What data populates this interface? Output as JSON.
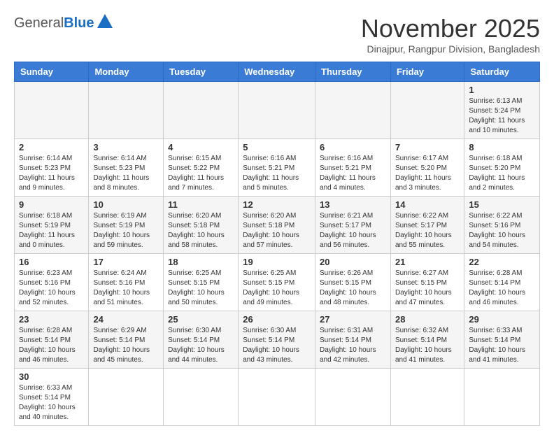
{
  "header": {
    "logo_general": "General",
    "logo_blue": "Blue",
    "month_title": "November 2025",
    "subtitle": "Dinajpur, Rangpur Division, Bangladesh"
  },
  "weekdays": [
    "Sunday",
    "Monday",
    "Tuesday",
    "Wednesday",
    "Thursday",
    "Friday",
    "Saturday"
  ],
  "weeks": [
    [
      {
        "day": "",
        "info": ""
      },
      {
        "day": "",
        "info": ""
      },
      {
        "day": "",
        "info": ""
      },
      {
        "day": "",
        "info": ""
      },
      {
        "day": "",
        "info": ""
      },
      {
        "day": "",
        "info": ""
      },
      {
        "day": "1",
        "info": "Sunrise: 6:13 AM\nSunset: 5:24 PM\nDaylight: 11 hours and 10 minutes."
      }
    ],
    [
      {
        "day": "2",
        "info": "Sunrise: 6:14 AM\nSunset: 5:23 PM\nDaylight: 11 hours and 9 minutes."
      },
      {
        "day": "3",
        "info": "Sunrise: 6:14 AM\nSunset: 5:23 PM\nDaylight: 11 hours and 8 minutes."
      },
      {
        "day": "4",
        "info": "Sunrise: 6:15 AM\nSunset: 5:22 PM\nDaylight: 11 hours and 7 minutes."
      },
      {
        "day": "5",
        "info": "Sunrise: 6:16 AM\nSunset: 5:21 PM\nDaylight: 11 hours and 5 minutes."
      },
      {
        "day": "6",
        "info": "Sunrise: 6:16 AM\nSunset: 5:21 PM\nDaylight: 11 hours and 4 minutes."
      },
      {
        "day": "7",
        "info": "Sunrise: 6:17 AM\nSunset: 5:20 PM\nDaylight: 11 hours and 3 minutes."
      },
      {
        "day": "8",
        "info": "Sunrise: 6:18 AM\nSunset: 5:20 PM\nDaylight: 11 hours and 2 minutes."
      }
    ],
    [
      {
        "day": "9",
        "info": "Sunrise: 6:18 AM\nSunset: 5:19 PM\nDaylight: 11 hours and 0 minutes."
      },
      {
        "day": "10",
        "info": "Sunrise: 6:19 AM\nSunset: 5:19 PM\nDaylight: 10 hours and 59 minutes."
      },
      {
        "day": "11",
        "info": "Sunrise: 6:20 AM\nSunset: 5:18 PM\nDaylight: 10 hours and 58 minutes."
      },
      {
        "day": "12",
        "info": "Sunrise: 6:20 AM\nSunset: 5:18 PM\nDaylight: 10 hours and 57 minutes."
      },
      {
        "day": "13",
        "info": "Sunrise: 6:21 AM\nSunset: 5:17 PM\nDaylight: 10 hours and 56 minutes."
      },
      {
        "day": "14",
        "info": "Sunrise: 6:22 AM\nSunset: 5:17 PM\nDaylight: 10 hours and 55 minutes."
      },
      {
        "day": "15",
        "info": "Sunrise: 6:22 AM\nSunset: 5:16 PM\nDaylight: 10 hours and 54 minutes."
      }
    ],
    [
      {
        "day": "16",
        "info": "Sunrise: 6:23 AM\nSunset: 5:16 PM\nDaylight: 10 hours and 52 minutes."
      },
      {
        "day": "17",
        "info": "Sunrise: 6:24 AM\nSunset: 5:16 PM\nDaylight: 10 hours and 51 minutes."
      },
      {
        "day": "18",
        "info": "Sunrise: 6:25 AM\nSunset: 5:15 PM\nDaylight: 10 hours and 50 minutes."
      },
      {
        "day": "19",
        "info": "Sunrise: 6:25 AM\nSunset: 5:15 PM\nDaylight: 10 hours and 49 minutes."
      },
      {
        "day": "20",
        "info": "Sunrise: 6:26 AM\nSunset: 5:15 PM\nDaylight: 10 hours and 48 minutes."
      },
      {
        "day": "21",
        "info": "Sunrise: 6:27 AM\nSunset: 5:15 PM\nDaylight: 10 hours and 47 minutes."
      },
      {
        "day": "22",
        "info": "Sunrise: 6:28 AM\nSunset: 5:14 PM\nDaylight: 10 hours and 46 minutes."
      }
    ],
    [
      {
        "day": "23",
        "info": "Sunrise: 6:28 AM\nSunset: 5:14 PM\nDaylight: 10 hours and 46 minutes."
      },
      {
        "day": "24",
        "info": "Sunrise: 6:29 AM\nSunset: 5:14 PM\nDaylight: 10 hours and 45 minutes."
      },
      {
        "day": "25",
        "info": "Sunrise: 6:30 AM\nSunset: 5:14 PM\nDaylight: 10 hours and 44 minutes."
      },
      {
        "day": "26",
        "info": "Sunrise: 6:30 AM\nSunset: 5:14 PM\nDaylight: 10 hours and 43 minutes."
      },
      {
        "day": "27",
        "info": "Sunrise: 6:31 AM\nSunset: 5:14 PM\nDaylight: 10 hours and 42 minutes."
      },
      {
        "day": "28",
        "info": "Sunrise: 6:32 AM\nSunset: 5:14 PM\nDaylight: 10 hours and 41 minutes."
      },
      {
        "day": "29",
        "info": "Sunrise: 6:33 AM\nSunset: 5:14 PM\nDaylight: 10 hours and 41 minutes."
      }
    ],
    [
      {
        "day": "30",
        "info": "Sunrise: 6:33 AM\nSunset: 5:14 PM\nDaylight: 10 hours and 40 minutes."
      },
      {
        "day": "",
        "info": ""
      },
      {
        "day": "",
        "info": ""
      },
      {
        "day": "",
        "info": ""
      },
      {
        "day": "",
        "info": ""
      },
      {
        "day": "",
        "info": ""
      },
      {
        "day": "",
        "info": ""
      }
    ]
  ]
}
